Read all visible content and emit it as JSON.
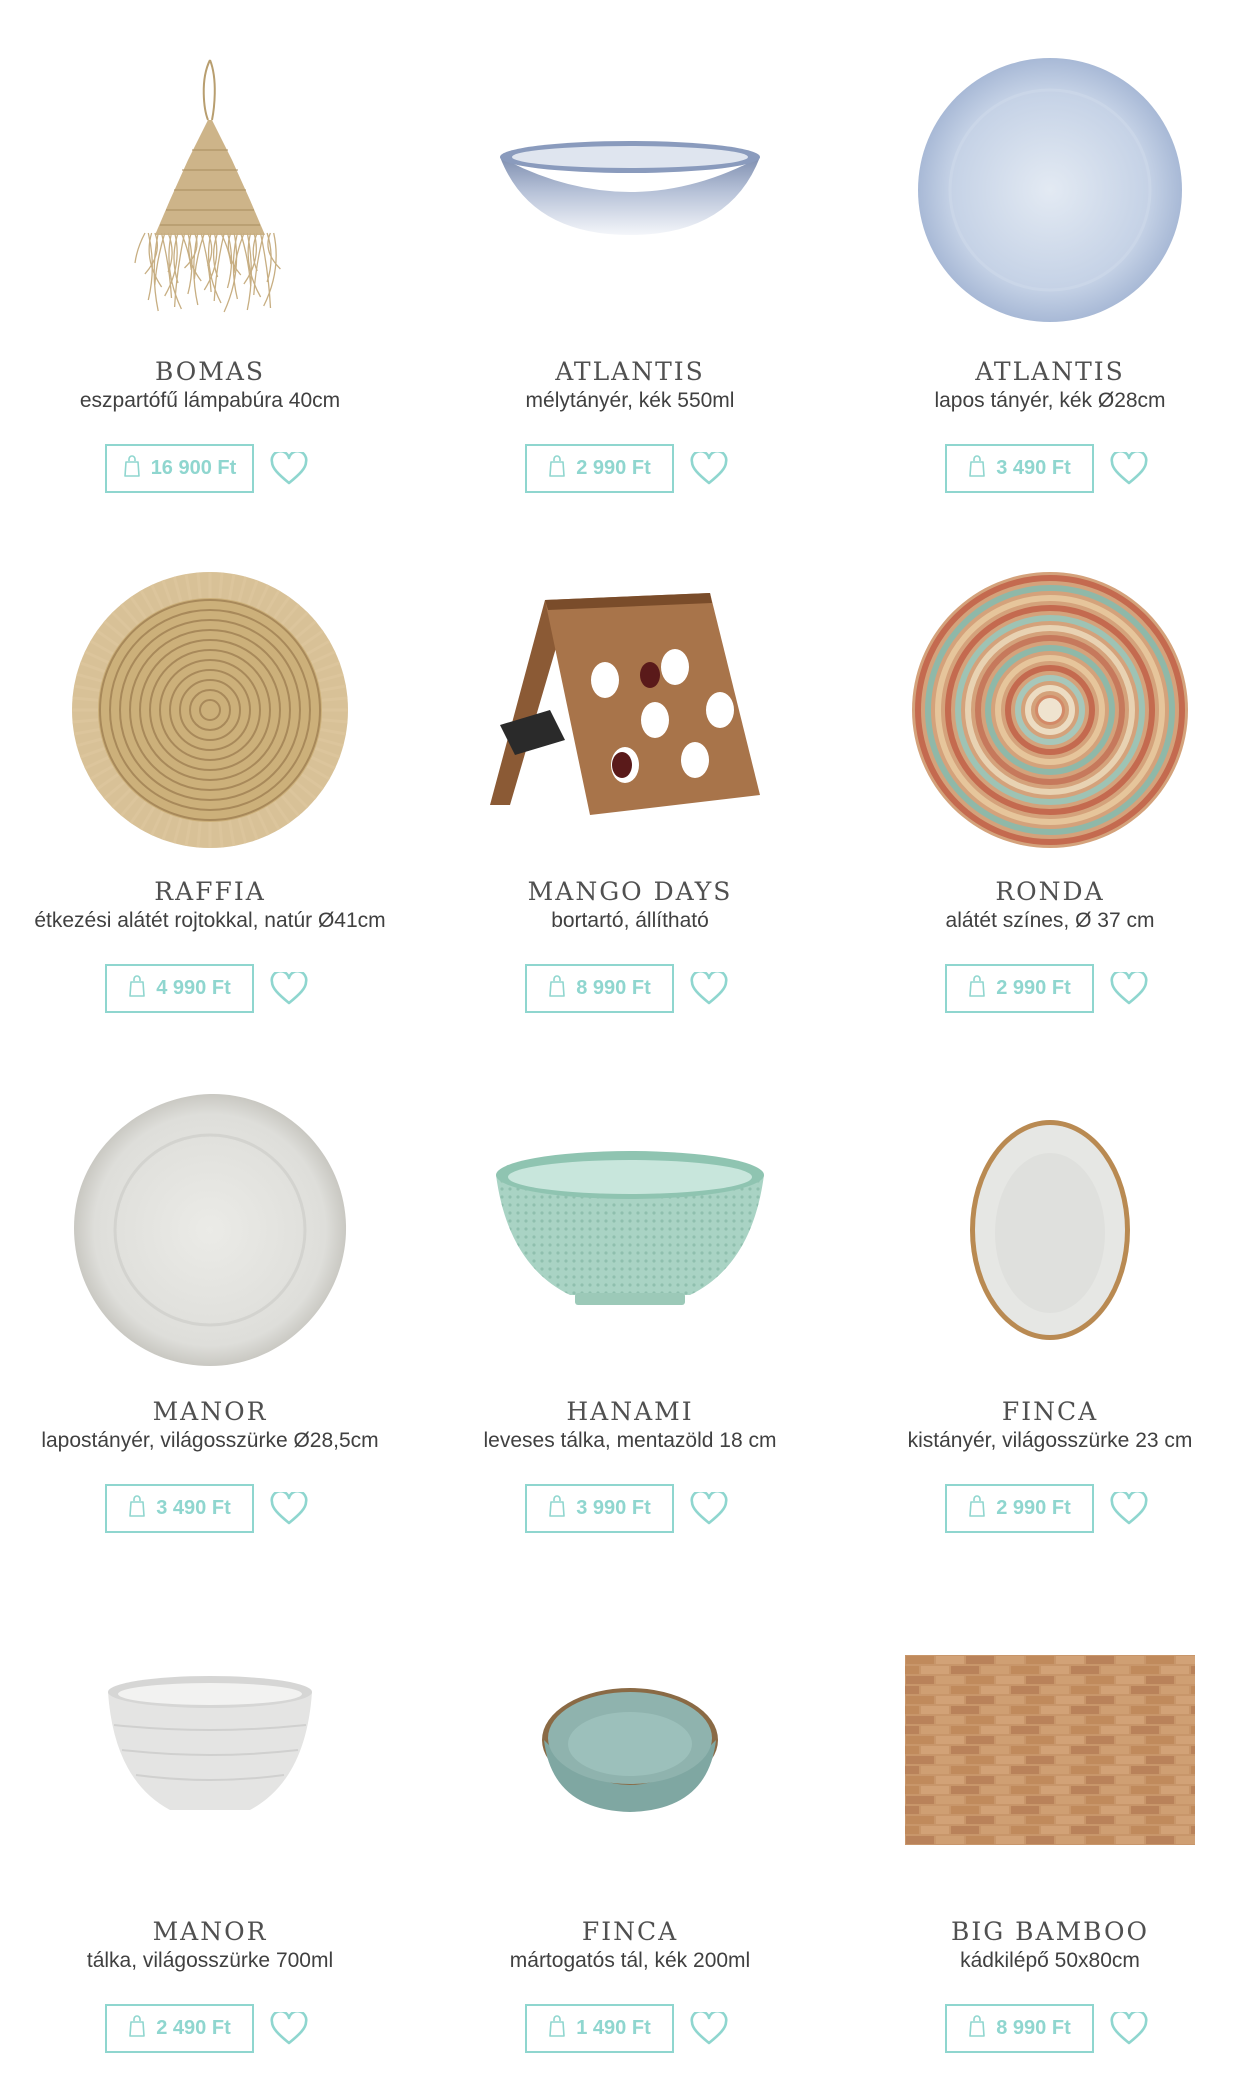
{
  "accent_color": "#8fd6cf",
  "products": [
    {
      "brand": "BOMAS",
      "desc": "eszpartófű lámpabúra 40cm",
      "price": "16 900 Ft",
      "image": "lamp-shade",
      "bag_icon": "bag-icon",
      "wish_icon": "heart-icon"
    },
    {
      "brand": "ATLANTIS",
      "desc": "mélytányér, kék 550ml",
      "price": "2 990 Ft",
      "image": "deep-plate",
      "bag_icon": "bag-icon",
      "wish_icon": "heart-icon"
    },
    {
      "brand": "ATLANTIS",
      "desc": "lapos tányér, kék Ø28cm",
      "price": "3 490 Ft",
      "image": "flat-plate-blue",
      "bag_icon": "bag-icon",
      "wish_icon": "heart-icon"
    },
    {
      "brand": "RAFFIA",
      "desc": "étkezési alátét rojtokkal, natúr Ø41cm",
      "price": "4 990 Ft",
      "image": "raffia-placemat",
      "bag_icon": "bag-icon",
      "wish_icon": "heart-icon"
    },
    {
      "brand": "MANGO DAYS",
      "desc": "bortartó, állítható",
      "price": "8 990 Ft",
      "image": "wine-rack",
      "bag_icon": "bag-icon",
      "wish_icon": "heart-icon"
    },
    {
      "brand": "RONDA",
      "desc": "alátét színes, Ø 37 cm",
      "price": "2 990 Ft",
      "image": "colorful-placemat",
      "bag_icon": "bag-icon",
      "wish_icon": "heart-icon"
    },
    {
      "brand": "MANOR",
      "desc": "lapostányér, világosszürke Ø28,5cm",
      "price": "3 490 Ft",
      "image": "grey-plate",
      "bag_icon": "bag-icon",
      "wish_icon": "heart-icon"
    },
    {
      "brand": "HANAMI",
      "desc": "leveses tálka, mentazöld 18 cm",
      "price": "3 990 Ft",
      "image": "mint-bowl",
      "bag_icon": "bag-icon",
      "wish_icon": "heart-icon"
    },
    {
      "brand": "FINCA",
      "desc": "kistányér, világosszürke 23 cm",
      "price": "2 990 Ft",
      "image": "oval-plate",
      "bag_icon": "bag-icon",
      "wish_icon": "heart-icon"
    },
    {
      "brand": "MANOR",
      "desc": "tálka, világosszürke 700ml",
      "price": "2 490 Ft",
      "image": "grey-bowl",
      "bag_icon": "bag-icon",
      "wish_icon": "heart-icon"
    },
    {
      "brand": "FINCA",
      "desc": "mártogatós tál, kék 200ml",
      "price": "1 490 Ft",
      "image": "dip-bowl",
      "bag_icon": "bag-icon",
      "wish_icon": "heart-icon"
    },
    {
      "brand": "BIG BAMBOO",
      "desc": "kádkilépő 50x80cm",
      "price": "8 990 Ft",
      "image": "bamboo-mat",
      "bag_icon": "bag-icon",
      "wish_icon": "heart-icon"
    }
  ]
}
